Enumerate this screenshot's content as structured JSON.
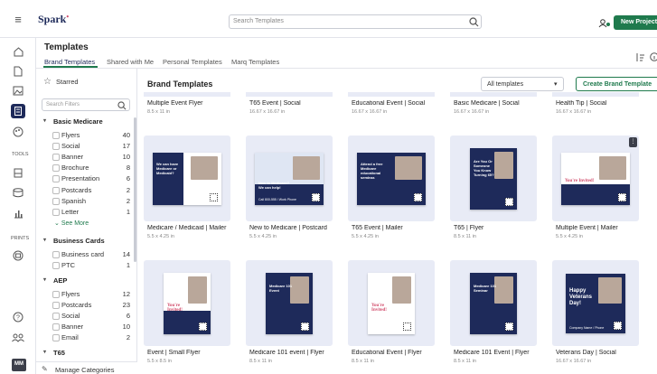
{
  "app": {
    "brand": "Spark",
    "new_project": "New Project"
  },
  "search": {
    "placeholder": "Search Templates"
  },
  "page": {
    "title": "Templates",
    "section_title": "Brand Templates",
    "create_button": "Create Brand Template",
    "dropdown": "All templates"
  },
  "tabs": [
    "Brand Templates",
    "Shared with Me",
    "Personal Templates",
    "Marq Templates"
  ],
  "filters": {
    "starred": "Starred",
    "search_placeholder": "Search Filters",
    "see_more": "See More",
    "manage": "Manage Categories"
  },
  "groups": [
    {
      "name": "Basic Medicare",
      "items": [
        [
          "Flyers",
          "40"
        ],
        [
          "Social",
          "17"
        ],
        [
          "Banner",
          "10"
        ],
        [
          "Brochure",
          "8"
        ],
        [
          "Presentation",
          "6"
        ],
        [
          "Postcards",
          "2"
        ],
        [
          "Spanish",
          "2"
        ],
        [
          "Letter",
          "1"
        ]
      ]
    },
    {
      "name": "Business Cards",
      "items": [
        [
          "Business card",
          "14"
        ],
        [
          "PTC",
          "1"
        ]
      ]
    },
    {
      "name": "AEP",
      "items": [
        [
          "Flyers",
          "12"
        ],
        [
          "Postcards",
          "23"
        ],
        [
          "Social",
          "6"
        ],
        [
          "Banner",
          "10"
        ],
        [
          "Email",
          "2"
        ]
      ]
    },
    {
      "name": "T65",
      "items": []
    }
  ],
  "rail": {
    "tools": "TOOLS",
    "prints": "PRINTS",
    "avatar": "MM"
  },
  "row0": [
    [
      "Multiple Event Flyer",
      "8.5 x 11 in"
    ],
    [
      "T65 Event | Social",
      "16.67 x 16.67 in"
    ],
    [
      "Educational Event | Social",
      "16.67 x 16.67 in"
    ],
    [
      "Basic Medicare | Social",
      "16.67 x 16.67 in"
    ],
    [
      "Health Tip | Social",
      "16.67 x 16.67 in"
    ]
  ],
  "row1": [
    [
      "Medicare / Medicaid | Mailer",
      "5.5 x 4.25 in"
    ],
    [
      "New to Medicare | Postcard",
      "5.5 x 4.25 in"
    ],
    [
      "T65 Event | Mailer",
      "5.5 x 4.25 in"
    ],
    [
      "T65 | Flyer",
      "8.5 x 11 in"
    ],
    [
      "Multiple Event | Mailer",
      "5.5 x 4.25 in"
    ]
  ],
  "row2": [
    [
      "Event | Small Flyer",
      "5.5 x 8.5 in"
    ],
    [
      "Medicare 101 event | Flyer",
      "8.5 x 11 in"
    ],
    [
      "Educational Event | Flyer",
      "8.5 x 11 in"
    ],
    [
      "Medicare 101 Event | Flyer",
      "8.5 x 11 in"
    ],
    [
      "Veterans Day | Social",
      "16.67 x 16.67 in"
    ]
  ],
  "thumbs": {
    "t1": "We can have Medicare or Medicaid?",
    "t2": "New to Medicare? We can help!",
    "t2b": "Call 800-555 / Work Phone",
    "t3": "Attend a free Medicare educational seminar.",
    "t4": "Are You Or Someone You Know Turning 65?",
    "t5": "You're Invited!",
    "t6": "You're Invited!",
    "t7": "Medicare 101 Event",
    "t8": "You're Invited!",
    "t9": "Medicare 101 Seminar",
    "t10": "Happy Veterans Day!",
    "t10b": "Company Name / Phone"
  },
  "colors": {
    "accent": "#1f7a4d",
    "navy": "#1e2a5a",
    "highlight": "#d14a6a"
  }
}
